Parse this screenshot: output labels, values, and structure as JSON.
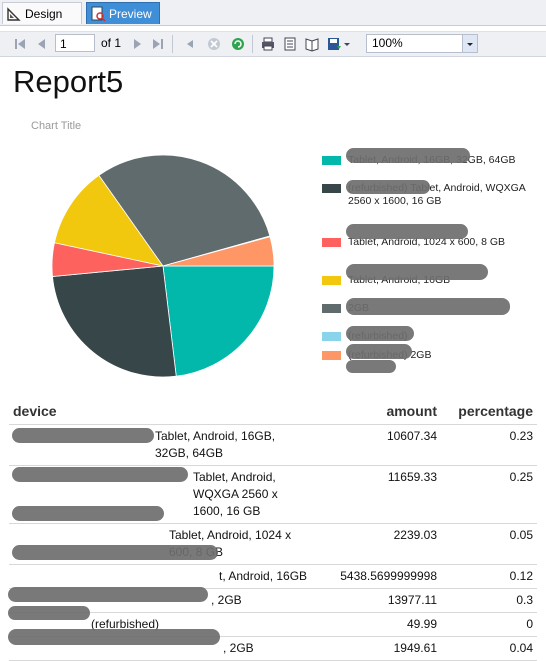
{
  "tabs": {
    "design": "Design",
    "preview": "Preview"
  },
  "toolbar": {
    "page_value": "1",
    "of_label": "of",
    "total_pages": "1",
    "zoom": "100%"
  },
  "report": {
    "title": "Report5",
    "chart_title": "Chart Title",
    "legend": [
      {
        "text": "Tablet, Android, 16GB, 32GB, 64GB",
        "color": "#01b8aa"
      },
      {
        "text": "(refurbished) Tablet, Android, WQXGA 2560 x 1600, 16 GB",
        "color": "#374649"
      },
      {
        "text": "Tablet, Android, 1024 x 600, 8 GB",
        "color": "#fd625e"
      },
      {
        "text": "Tablet, Android, 16GB",
        "color": "#f2c80f"
      },
      {
        "text": "2GB",
        "color": "#5f6b6d"
      },
      {
        "text": "(refurbished)",
        "color": "#8ad4eb"
      },
      {
        "text": "(refurbished) 2GB",
        "color": "#fe9666"
      }
    ]
  },
  "chart_data": {
    "type": "pie",
    "title": "Chart Title",
    "series": [
      {
        "name": "Tablet, Android, 16GB, 32GB, 64GB",
        "value": 10607.34,
        "color": "#01b8aa"
      },
      {
        "name": "(refurbished) Tablet, Android, WQXGA 2560 x 1600, 16 GB",
        "value": 11659.33,
        "color": "#374649"
      },
      {
        "name": "Tablet, Android, 1024 x 600, 8 GB",
        "value": 2239.03,
        "color": "#fd625e"
      },
      {
        "name": "Tablet, Android, 16GB",
        "value": 5438.5699999998,
        "color": "#f2c80f"
      },
      {
        "name": "2GB",
        "value": 13977.11,
        "color": "#5f6b6d"
      },
      {
        "name": "(refurbished)",
        "value": 49.99,
        "color": "#8ad4eb"
      },
      {
        "name": "(refurbished) 2GB",
        "value": 1949.61,
        "color": "#fe9666"
      }
    ]
  },
  "table": {
    "headers": {
      "device": "device",
      "amount": "amount",
      "percentage": "percentage"
    },
    "rows": [
      {
        "device": "Tablet, Android, 16GB, 32GB, 64GB",
        "amount": "10607.34",
        "percentage": "0.23"
      },
      {
        "device": "Tablet, Android, WQXGA 2560 x 1600, 16 GB",
        "amount": "11659.33",
        "percentage": "0.25"
      },
      {
        "device": "Tablet, Android, 1024 x 600, 8 GB",
        "amount": "2239.03",
        "percentage": "0.05"
      },
      {
        "device": "t, Android, 16GB",
        "amount": "5438.5699999998",
        "percentage": "0.12"
      },
      {
        "device": ", 2GB",
        "amount": "13977.11",
        "percentage": "0.3"
      },
      {
        "device": "(refurbished)",
        "amount": "49.99",
        "percentage": "0"
      },
      {
        "device": ", 2GB",
        "amount": "1949.61",
        "percentage": "0.04"
      }
    ]
  }
}
